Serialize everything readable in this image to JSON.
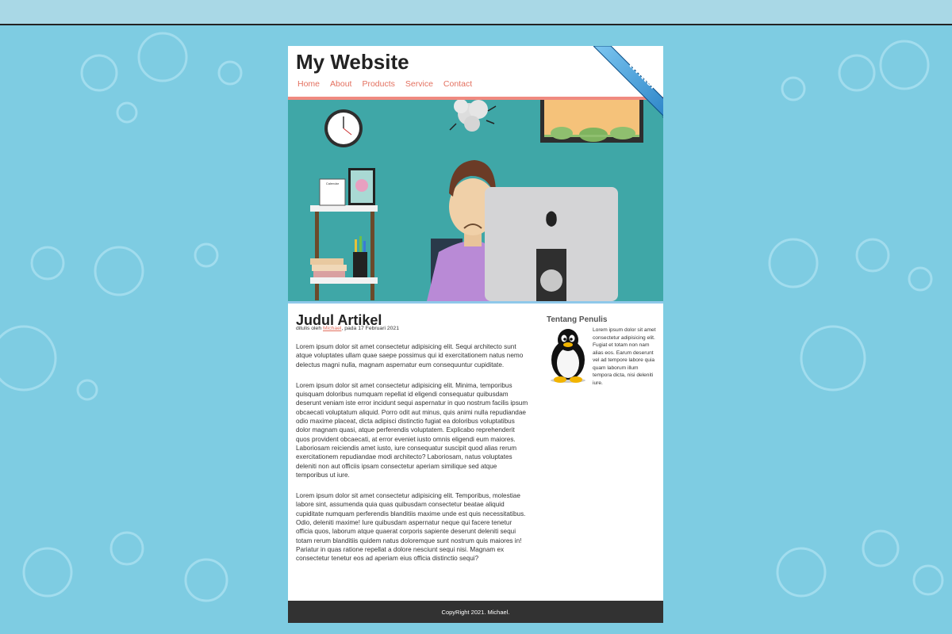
{
  "site": {
    "title": "My Website"
  },
  "nav": [
    "Home",
    "About",
    "Products",
    "Service",
    "Contact"
  ],
  "twitter_ribbon": {
    "label": "twitter"
  },
  "hero": {
    "calendar_label": "Calendar"
  },
  "article": {
    "title": "Judul Artikel",
    "byline_prefix": "ditulis oleh ",
    "author": "Michael",
    "byline_suffix": ", pada 17 Februari 2021",
    "paragraphs": [
      "Lorem ipsum dolor sit amet consectetur adipisicing elit. Sequi architecto sunt atque voluptates ullam quae saepe possimus qui id exercitationem natus nemo delectus magni nulla, magnam aspernatur eum consequuntur cupiditate.",
      "Lorem ipsum dolor sit amet consectetur adipisicing elit. Minima, temporibus quisquam doloribus numquam repellat id eligendi consequatur quibusdam deserunt veniam iste error incidunt sequi aspernatur in quo nostrum facilis ipsum obcaecati voluptatum aliquid. Porro odit aut minus, quis animi nulla repudiandae odio maxime placeat, dicta adipisci distinctio fugiat ea doloribus voluptatibus dolor magnam quasi, atque perferendis voluptatem. Explicabo reprehenderit quos provident obcaecati, at error eveniet iusto omnis eligendi eum maiores. Laboriosam reiciendis amet iusto, iure consequatur suscipit quod alias rerum exercitationem repudiandae modi architecto? Laboriosam, natus voluptates deleniti non aut officiis ipsam consectetur aperiam similique sed atque temporibus ut iure.",
      "Lorem ipsum dolor sit amet consectetur adipisicing elit. Temporibus, molestiae labore sint, assumenda quia quas quibusdam consectetur beatae aliquid cupiditate numquam perferendis blanditiis maxime unde est quis necessitatibus. Odio, deleniti maxime! Iure quibusdam aspernatur neque qui facere tenetur officia quos, laborum atque quaerat corporis sapiente deserunt deleniti sequi totam rerum blanditiis quidem natus doloremque sunt nostrum quis maiores in! Pariatur in quas ratione repellat a dolore nesciunt sequi nisi. Magnam ex consectetur tenetur eos ad aperiam eius officia distinctio sequi?"
    ]
  },
  "sidebar": {
    "heading": "Tentang Penulis",
    "text": "Lorem ipsum dolor sit amet consectetur adipisicing elit. Fugiat et totam non nam alias eos. Earum deserunt vel ad tempore labore quia quam laborum illum tempora dicta, nisi deleniti iure."
  },
  "footer": {
    "text": "CopyRight 2021. Michael."
  },
  "colors": {
    "background": "#7ecce2",
    "nav_link": "#e3705f",
    "header_border": "#f08a80",
    "hero_bg": "#3fa7a7",
    "footer_bg": "#323232"
  }
}
